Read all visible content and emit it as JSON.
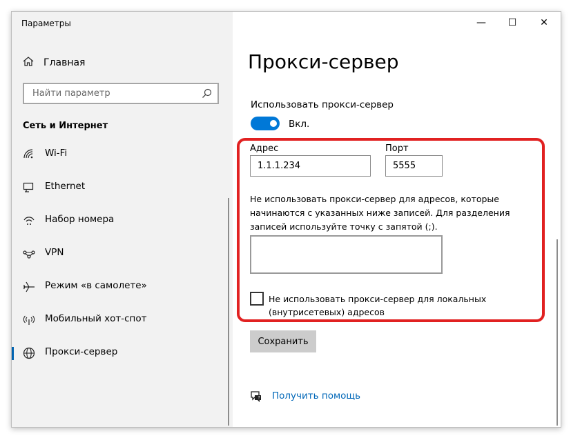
{
  "window": {
    "title": "Параметры",
    "controls": {
      "minimize": "—",
      "maximize": "☐",
      "close": "✕"
    }
  },
  "sidebar": {
    "home_label": "Главная",
    "search_placeholder": "Найти параметр",
    "section_title": "Сеть и Интернет",
    "items": [
      {
        "label": "Wi-Fi",
        "icon": "wifi-icon",
        "active": false
      },
      {
        "label": "Ethernet",
        "icon": "ethernet-icon",
        "active": false
      },
      {
        "label": "Набор номера",
        "icon": "dial-up-icon",
        "active": false
      },
      {
        "label": "VPN",
        "icon": "vpn-icon",
        "active": false
      },
      {
        "label": "Режим «в самолете»",
        "icon": "airplane-icon",
        "active": false
      },
      {
        "label": "Мобильный хот-спот",
        "icon": "hotspot-icon",
        "active": false
      },
      {
        "label": "Прокси-сервер",
        "icon": "globe-icon",
        "active": true
      }
    ]
  },
  "main": {
    "page_title": "Прокси-сервер",
    "use_proxy_label": "Использовать прокси-сервер",
    "toggle_state": "Вкл.",
    "toggle_on": true,
    "address_label": "Адрес",
    "address_value": "1.1.1.234",
    "port_label": "Порт",
    "port_value": "5555",
    "exceptions_note": "Не использовать прокси-сервер для адресов, которые начинаются с указанных ниже записей. Для разделения записей используйте точку с запятой (;).",
    "exceptions_value": "",
    "local_checkbox_label": "Не использовать прокси-сервер для локальных (внутрисетевых) адресов",
    "local_checkbox_checked": false,
    "save_label": "Сохранить",
    "help_label": "Получить помощь"
  },
  "colors": {
    "accent": "#0078d7",
    "highlight": "#e12121",
    "link": "#0067b8",
    "sidebar_bg": "#f2f2f2"
  }
}
